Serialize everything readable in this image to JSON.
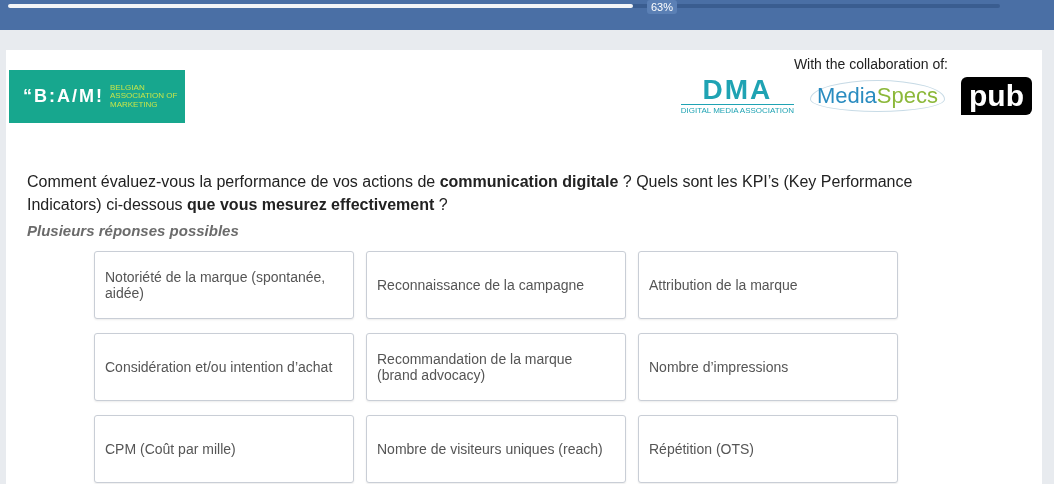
{
  "progress": {
    "level": 0.63,
    "label": "63%"
  },
  "header": {
    "logo": {
      "mark": "“B:A/M!",
      "tagline": "BELGIAN ASSOCIATION OF MARKETING"
    },
    "collaboration_label": "With the collaboration of:",
    "partners": [
      {
        "kind": "dma",
        "name": "DMA",
        "subtitle": "DIGITAL MEDIA ASSOCIATION"
      },
      {
        "kind": "mediaspecs",
        "name": "Media",
        "name_2": "Specs"
      },
      {
        "kind": "pub",
        "name": "pub"
      }
    ]
  },
  "question": "Comment évaluez-vous la performance de vos actions de **communication digitale** ? Quels sont les KPI’s (Key Performance Indicators) ci-dessous **que vous mesurez effectivement** ?",
  "hint": "Plusieurs réponses possibles",
  "options": [
    {
      "label": "Notoriété de la marque (spontanée, aidée)",
      "selected": false
    },
    {
      "label": "Reconnaissance de la campagne",
      "selected": false
    },
    {
      "label": "Attribution de la marque",
      "selected": false
    },
    {
      "label": "Considération et/ou intention d’achat",
      "selected": false
    },
    {
      "label": "Recommandation de la marque (brand advocacy)",
      "selected": false
    },
    {
      "label": "Nombre d’impressions",
      "selected": false
    },
    {
      "label": "CPM (Coût par mille)",
      "selected": false
    },
    {
      "label": "Nombre de visiteurs uniques (reach)",
      "selected": false
    },
    {
      "label": "Répétition (OTS)",
      "selected": false
    }
  ]
}
